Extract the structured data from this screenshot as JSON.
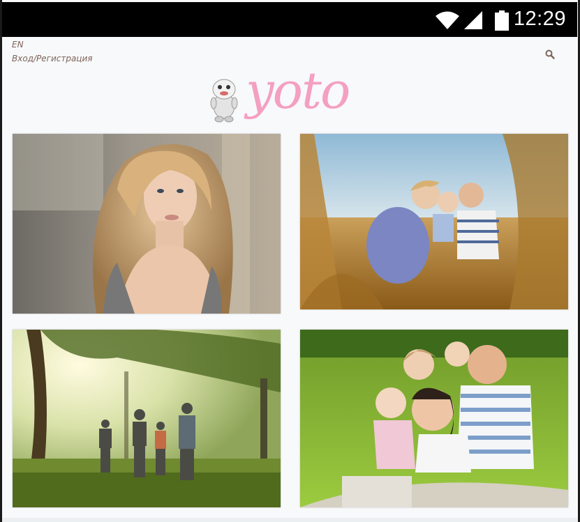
{
  "status_bar": {
    "time": "12:29"
  },
  "header": {
    "language": "EN",
    "login_label": "Вход/Регистрация",
    "logo_text": "yoto"
  },
  "gallery": {
    "photos": [
      {
        "subject": "portrait of a woman with long wavy blonde hair"
      },
      {
        "subject": "family sitting in tall golden grass"
      },
      {
        "subject": "family walking hand in hand in a sunlit park"
      },
      {
        "subject": "smiling family with children sitting on green lawn"
      }
    ]
  },
  "colors": {
    "accent_text": "#7d6359",
    "logo_pink": "#f4a0c0",
    "status_bar": "#000000",
    "page_bg": "#f8f9fa"
  }
}
